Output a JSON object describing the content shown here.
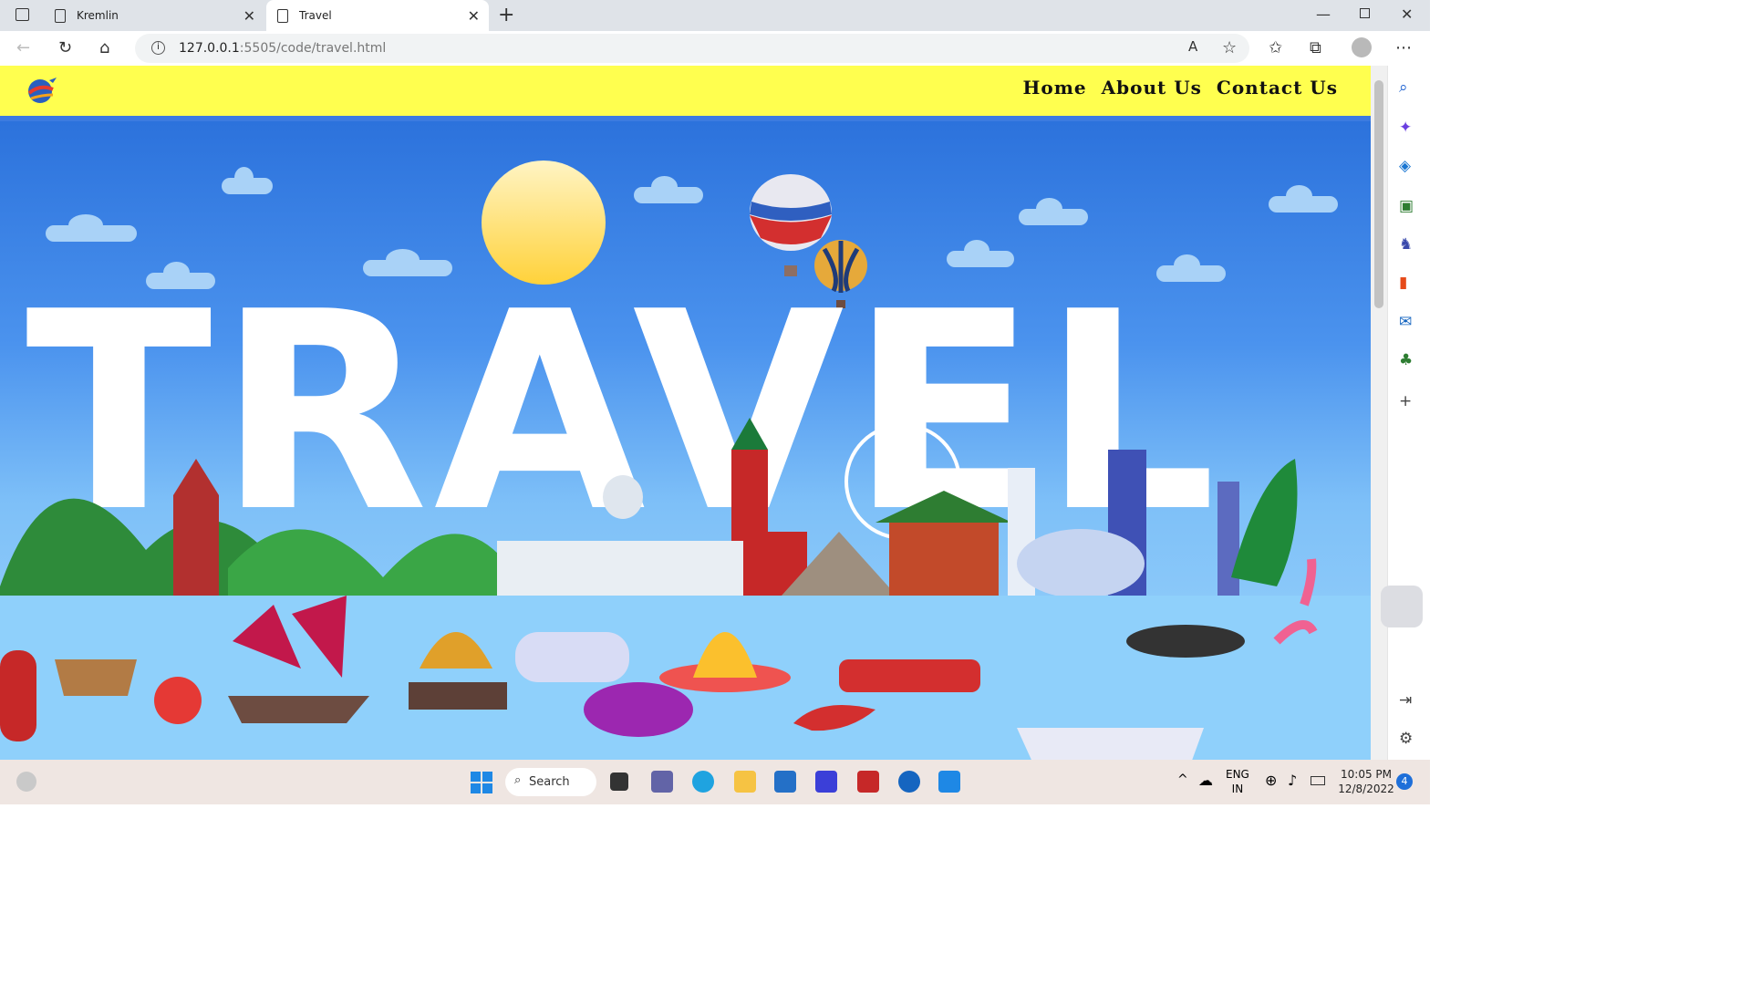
{
  "browser": {
    "tabs": [
      {
        "title": "Kremlin"
      },
      {
        "title": "Travel"
      }
    ],
    "url_host": "127.0.0.1",
    "url_rest": ":5505/code/travel.html"
  },
  "site": {
    "nav": [
      "Home",
      "About Us",
      "Contact Us"
    ],
    "hero_word": "TRAVEL"
  },
  "taskbar": {
    "search_label": "Search",
    "lang_top": "ENG",
    "lang_bottom": "IN",
    "time": "10:05 PM",
    "date": "12/8/2022",
    "notification_count": "4"
  },
  "colors": {
    "header_bg": "#ffff4f",
    "sky_top": "#2c72dc",
    "sky_bottom": "#9fd6fb",
    "sun": "#ffd54a"
  },
  "icons": [
    "sidebar-toggle-icon",
    "page-icon",
    "close-icon",
    "new-tab-icon",
    "back-icon",
    "refresh-icon",
    "home-icon",
    "info-icon",
    "read-aloud-icon",
    "favorite-icon",
    "favorites-icon",
    "collections-icon",
    "profile-icon",
    "more-icon",
    "search-icon",
    "copilot-icon",
    "shopping-icon",
    "tools-icon",
    "games-icon",
    "office-icon",
    "outlook-icon",
    "tree-icon",
    "add-icon",
    "settings-icon",
    "windows-start-icon"
  ]
}
